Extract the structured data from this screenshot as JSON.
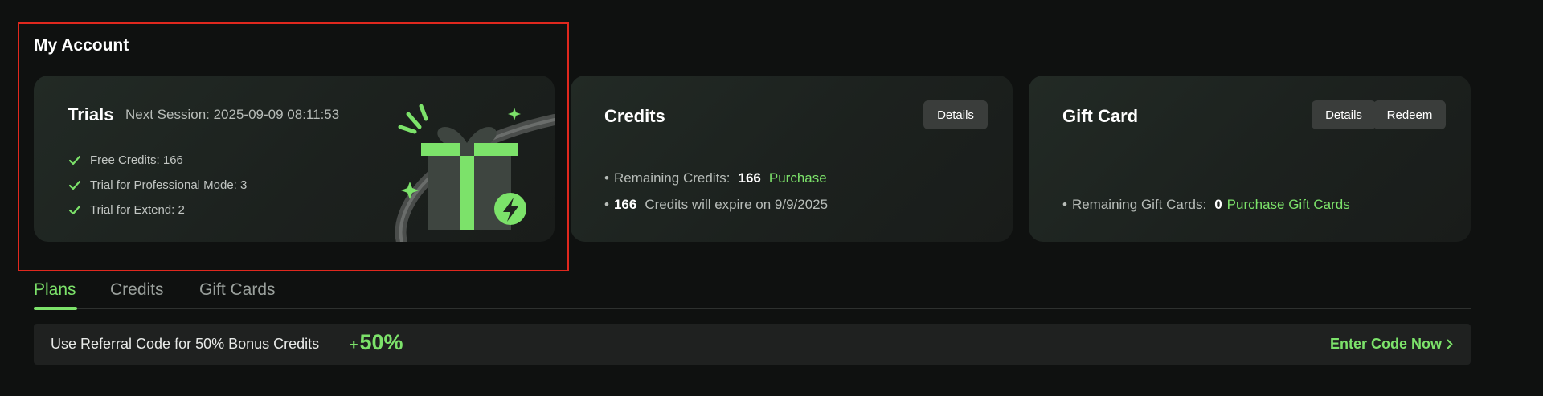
{
  "section": {
    "title": "My Account"
  },
  "trials": {
    "title": "Trials",
    "session": "Next Session: 2025-09-09 08:11:53",
    "items": [
      {
        "label": "Free Credits: 166"
      },
      {
        "label": "Trial for Professional Mode: 3"
      },
      {
        "label": "Trial for Extend: 2"
      }
    ]
  },
  "credits_card": {
    "title": "Credits",
    "details_label": "Details",
    "remaining_label": "Remaining Credits:",
    "remaining_value": "166",
    "purchase_label": "Purchase",
    "expire_value": "166",
    "expire_text": "Credits will expire on 9/9/2025"
  },
  "gift_card": {
    "title": "Gift Card",
    "details_label": "Details",
    "redeem_label": "Redeem",
    "remaining_label": "Remaining Gift Cards:",
    "remaining_value": "0",
    "purchase_label": "Purchase Gift Cards"
  },
  "tabs": [
    {
      "label": "Plans",
      "active": true
    },
    {
      "label": "Credits",
      "active": false
    },
    {
      "label": "Gift Cards",
      "active": false
    }
  ],
  "referral": {
    "text": "Use Referral Code for 50% Bonus Credits",
    "bonus_plus": "+",
    "bonus_value": "50%",
    "cta_label": "Enter Code Now"
  },
  "colors": {
    "accent": "#7ce26a",
    "background": "#0f1110",
    "highlight": "#e0281e"
  },
  "icons": [
    "check-icon",
    "gift-icon",
    "lightning-icon",
    "chevron-right-icon"
  ]
}
